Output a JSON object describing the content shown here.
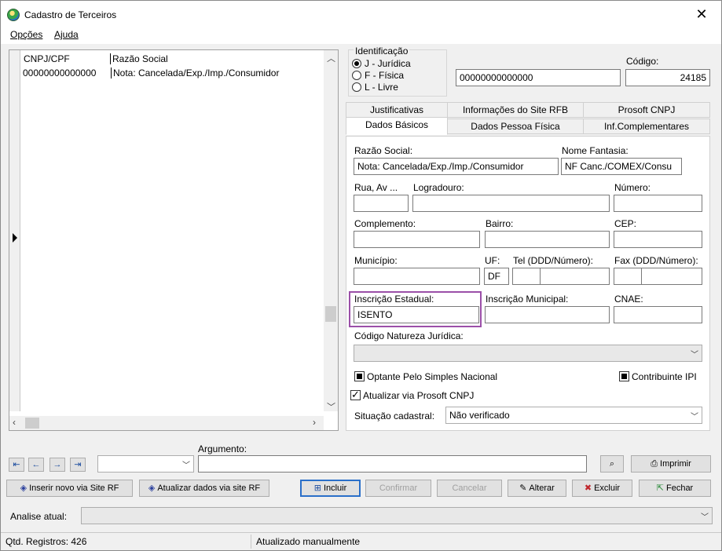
{
  "window": {
    "title": "Cadastro de Terceiros",
    "close_glyph": "✕"
  },
  "menu": {
    "items": [
      {
        "label": "Opções"
      },
      {
        "label": "Ajuda"
      }
    ]
  },
  "grid": {
    "headers": [
      "CNPJ/CPF",
      "Razão Social"
    ],
    "rows": [
      {
        "cnpj": "00000000000000",
        "razao": "Nota: Cancelada/Exp./Imp./Consumidor"
      }
    ]
  },
  "identificacao": {
    "legend": "Identificação",
    "options": [
      {
        "label": "J - Jurídica",
        "selected": true
      },
      {
        "label": "F - Física",
        "selected": false
      },
      {
        "label": "L - Livre",
        "selected": false
      }
    ],
    "cnpj_value": "00000000000000",
    "codigo_label": "Código:",
    "codigo_value": "24185"
  },
  "tabs": {
    "row1": [
      "Justificativas",
      "Informações do Site RFB",
      "Prosoft CNPJ"
    ],
    "row2": [
      "Dados Básicos",
      "Dados Pessoa Física",
      "Inf.Complementares"
    ],
    "active": "Dados Básicos"
  },
  "form": {
    "razao_social": {
      "label": "Razão Social:",
      "value": "Nota: Cancelada/Exp./Imp./Consumidor"
    },
    "nome_fantasia": {
      "label": "Nome Fantasia:",
      "value": "NF Canc./COMEX/Consu"
    },
    "rua": {
      "label": "Rua, Av ...",
      "value": ""
    },
    "logradouro": {
      "label": "Logradouro:",
      "value": ""
    },
    "numero": {
      "label": "Número:",
      "value": ""
    },
    "complemento": {
      "label": "Complemento:",
      "value": ""
    },
    "bairro": {
      "label": "Bairro:",
      "value": ""
    },
    "cep": {
      "label": "CEP:",
      "value": ""
    },
    "municipio": {
      "label": "Município:",
      "value": ""
    },
    "uf": {
      "label": "UF:",
      "value": "DF"
    },
    "tel": {
      "label": "Tel (DDD/Número):",
      "ddd": "",
      "numero": ""
    },
    "fax": {
      "label": "Fax (DDD/Número):",
      "ddd": "",
      "numero": ""
    },
    "inscricao_estadual": {
      "label": "Inscrição Estadual:",
      "value": "ISENTO"
    },
    "inscricao_municipal": {
      "label": "Inscrição Municipal:",
      "value": ""
    },
    "cnae": {
      "label": "CNAE:",
      "value": ""
    },
    "natureza_juridica": {
      "label": "Código Natureza Jurídica:",
      "value": ""
    },
    "optante_simples": {
      "label": "Optante Pelo Simples Nacional",
      "state": "indeterminate"
    },
    "contribuinte_ipi": {
      "label": "Contribuinte IPI",
      "state": "indeterminate"
    },
    "atualizar_prosoft": {
      "label": "Atualizar via Prosoft CNPJ",
      "checked": true
    },
    "situacao": {
      "label": "Situação cadastral:",
      "value": "Não verificado"
    }
  },
  "search": {
    "argumento_label": "Argumento:",
    "argumento_value": "",
    "field_select_value": "",
    "nav_buttons": [
      "first",
      "prev",
      "next",
      "last"
    ],
    "imprimir_label": "Imprimir"
  },
  "actions": {
    "inserir_rf": "Inserir novo via Site RF",
    "atualizar_rf": "Atualizar dados via site RF",
    "incluir": "Incluir",
    "confirmar": "Confirmar",
    "cancelar": "Cancelar",
    "alterar": "Alterar",
    "excluir": "Excluir",
    "fechar": "Fechar"
  },
  "analise": {
    "label": "Analise atual:",
    "value": ""
  },
  "status": {
    "registros": "Qtd. Registros: 426",
    "atualizacao": "Atualizado manualmente"
  },
  "colors": {
    "highlight_border": "#9b4fa8",
    "focus_border": "#2a6fc9"
  }
}
